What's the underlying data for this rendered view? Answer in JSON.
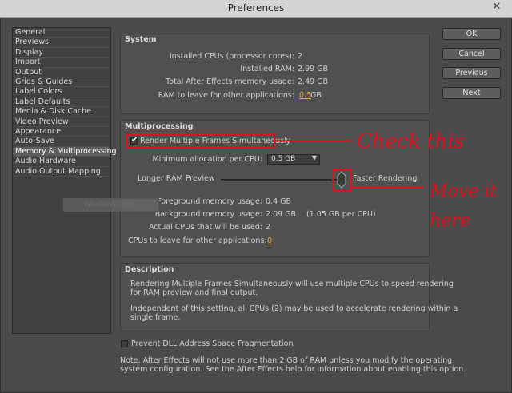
{
  "window": {
    "title": "Preferences",
    "close_glyph": "✕"
  },
  "sidebar": {
    "items": [
      {
        "label": "General"
      },
      {
        "label": "Previews"
      },
      {
        "label": "Display"
      },
      {
        "label": "Import"
      },
      {
        "label": "Output"
      },
      {
        "label": "Grids & Guides"
      },
      {
        "label": "Label Colors"
      },
      {
        "label": "Label Defaults"
      },
      {
        "label": "Media & Disk Cache"
      },
      {
        "label": "Video Preview"
      },
      {
        "label": "Appearance"
      },
      {
        "label": "Auto-Save"
      },
      {
        "label": "Memory & Multiprocessing",
        "selected": true
      },
      {
        "label": "Audio Hardware"
      },
      {
        "label": "Audio Output Mapping"
      }
    ]
  },
  "buttons": {
    "ok": "OK",
    "cancel": "Cancel",
    "previous": "Previous",
    "next": "Next"
  },
  "system": {
    "heading": "System",
    "installed_cpus_label": "Installed CPUs (processor cores):",
    "installed_cpus_value": "2",
    "installed_ram_label": "Installed RAM:",
    "installed_ram_value": "2.99 GB",
    "total_memory_label": "Total After Effects memory usage:",
    "total_memory_value": "2.49 GB",
    "ram_leave_label": "RAM to leave for other applications:",
    "ram_leave_value": "0.5",
    "ram_leave_unit": "GB"
  },
  "multiprocessing": {
    "heading": "Multiprocessing",
    "render_multiple_label": "Render Multiple Frames Simultaneously",
    "render_multiple_checked": true,
    "min_alloc_label": "Minimum allocation per CPU:",
    "min_alloc_value": "0.5 GB",
    "slider_left_label": "Longer RAM Preview",
    "slider_right_label": "Faster Rendering",
    "slider_position": 1.0,
    "fg_mem_label": "Foreground memory usage:",
    "fg_mem_value": "0.4 GB",
    "bg_mem_label": "Background memory usage:",
    "bg_mem_value": "2.09 GB",
    "bg_mem_per_cpu": "(1.05 GB per CPU)",
    "actual_cpus_label": "Actual CPUs that will be used:",
    "actual_cpus_value": "2",
    "cpus_leave_label": "CPUs to leave for other applications:",
    "cpus_leave_value": "0"
  },
  "description": {
    "heading": "Description",
    "para1_line1": "Rendering Multiple Frames Simultaneously will use multiple CPUs to speed rendering",
    "para1_line2": "for RAM preview and final output.",
    "para2_line1": "Independent of this setting, all CPUs (2) may be used to accelerate rendering within a",
    "para2_line2": "single frame."
  },
  "prevent_dll_label": "Prevent DLL Address Space Fragmentation",
  "prevent_dll_checked": false,
  "note_line1": "Note: After Effects will not use more than 2 GB of RAM unless you modify the operating",
  "note_line2": "system configuration. See the After Effects help for information about enabling this option.",
  "overlay": {
    "watermark_text": "Windows Snip",
    "annotation_check": "Check this",
    "annotation_move_1": "Move it",
    "annotation_move_2": "here"
  },
  "colors": {
    "annotation_red": "#e0101c",
    "value_orange": "#e0a43a",
    "panel": "#505050",
    "background": "#4b4b4b"
  }
}
